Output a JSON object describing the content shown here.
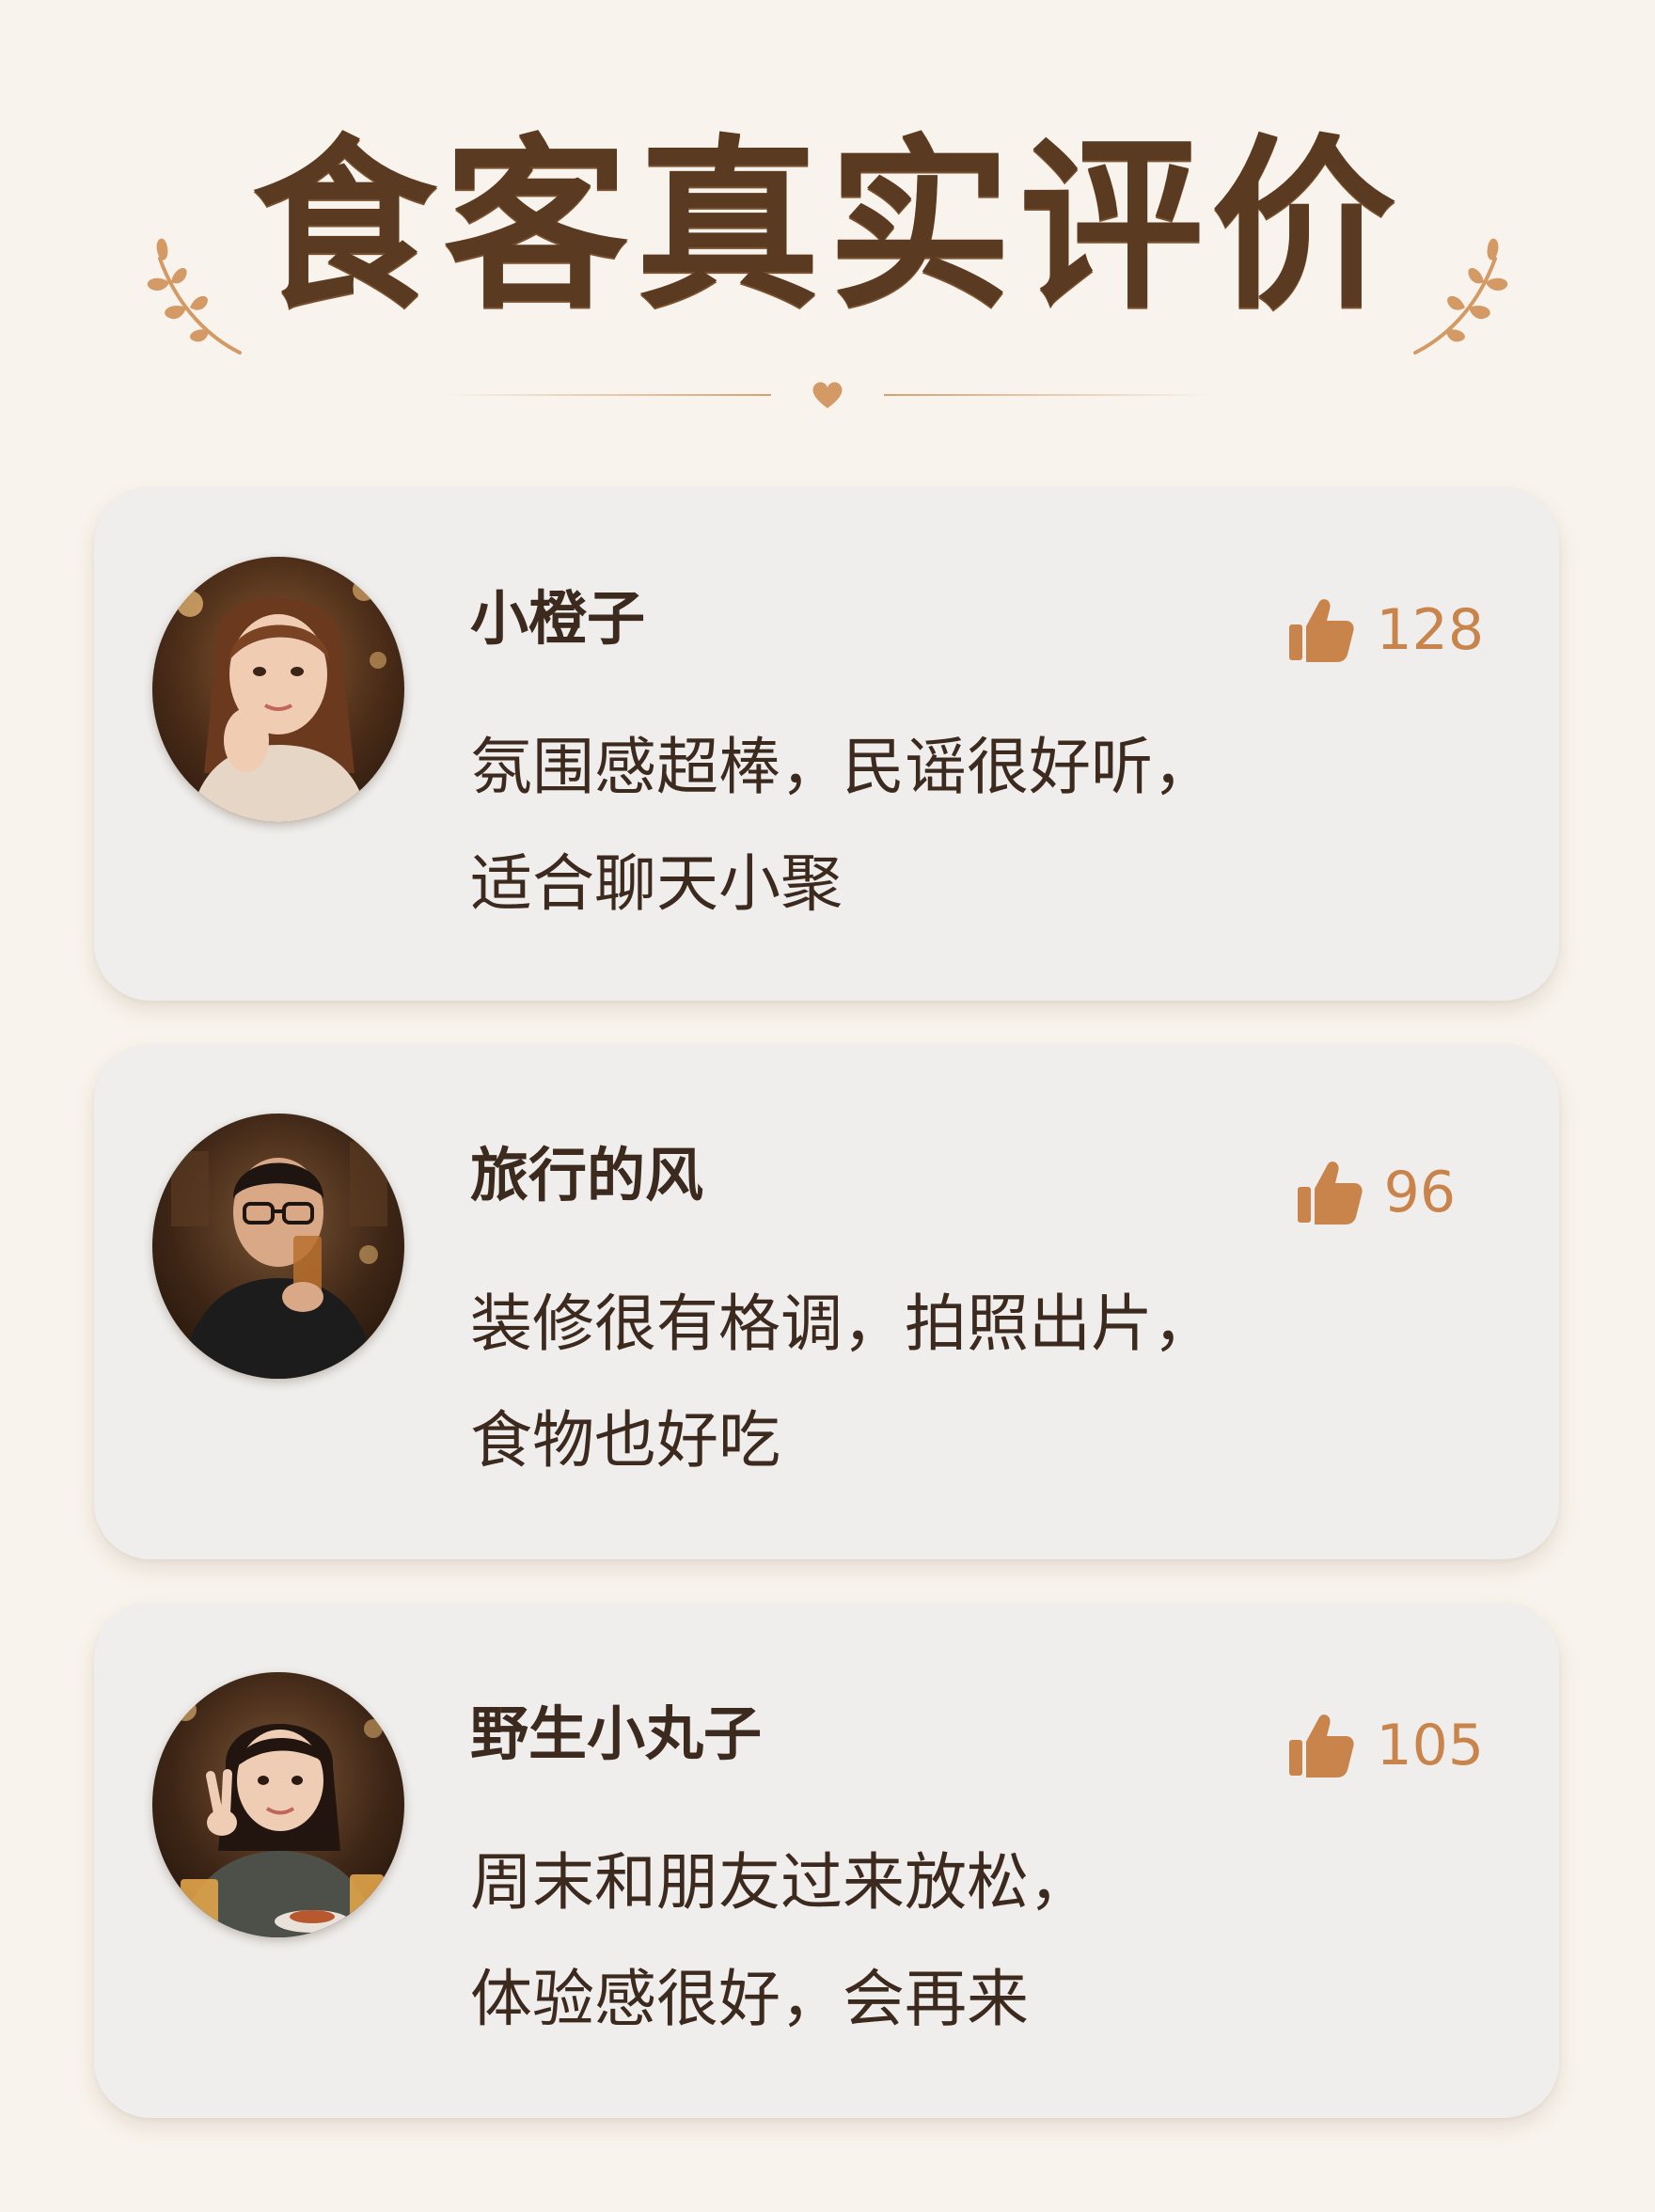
{
  "header": {
    "title": "食客真实评价",
    "decor_icons": [
      "laurel-left-icon",
      "laurel-right-icon",
      "heart-icon"
    ]
  },
  "reviews": [
    {
      "username": "小橙子",
      "likes": "128",
      "comment_lines": [
        "氛围感超棒，民谣很好听，",
        "适合聊天小聚"
      ],
      "avatar": "young woman with long brown hair, resting chin on hand, warm-lit restaurant"
    },
    {
      "username": "旅行的风",
      "likes": "96",
      "comment_lines": [
        "装修很有格调，拍照出片，",
        "食物也好吃"
      ],
      "avatar": "young man with glasses in black t-shirt drinking from a glass, restaurant"
    },
    {
      "username": "野生小丸子",
      "likes": "105",
      "comment_lines": [
        "周末和朋友过来放松，",
        "体验感很好，会再来"
      ],
      "avatar": "smiling girl with bangs making peace sign, beer and food on table"
    }
  ],
  "colors": {
    "background": "#f8f3ec",
    "card": "#efeeec",
    "title": "#5a3a20",
    "text": "#3d2a1f",
    "accent": "#c8844a"
  }
}
